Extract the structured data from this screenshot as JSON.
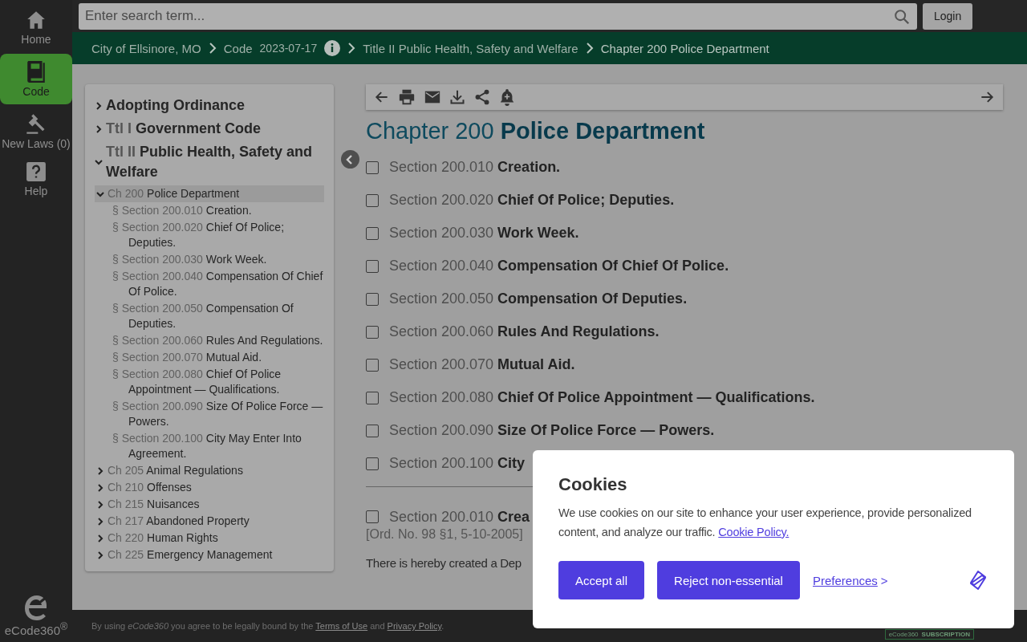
{
  "rail": {
    "items": [
      {
        "label": "Home",
        "selected": false
      },
      {
        "label": "Code",
        "selected": true
      },
      {
        "label": "New Laws (0)",
        "selected": false
      },
      {
        "label": "Help",
        "selected": false
      }
    ],
    "logo": "eCode360$^{®}$"
  },
  "search": {
    "placeholder": "Enter search term..."
  },
  "login_button": "Login",
  "breadcrumb": [
    {
      "text": "City of Ellsinore, MO"
    },
    {
      "text": "Code",
      "version": "2023-07-17"
    },
    {
      "text": "Title II Public Health, Safety and Welfare"
    },
    {
      "text": "Chapter 200 Police Department"
    }
  ],
  "toc": [
    {
      "title": "Adopting Ordinance",
      "expanded": false
    },
    {
      "prefix": "Ttl I",
      "title": "Government Code",
      "expanded": false
    },
    {
      "prefix": "Ttl II",
      "title": "Public Health, Safety and Welfare",
      "expanded": true,
      "children": [
        {
          "prefix": "Ch 200",
          "title": "Police Department",
          "expanded": true,
          "selected": true,
          "children": [
            {
              "prefix": "§ Section 200.010",
              "title": "Creation."
            },
            {
              "prefix": "§ Section 200.020",
              "title": "Chief Of Police; Deputies."
            },
            {
              "prefix": "§ Section 200.030",
              "title": "Work Week."
            },
            {
              "prefix": "§ Section 200.040",
              "title": "Compensation Of Chief Of Police."
            },
            {
              "prefix": "§ Section 200.050",
              "title": "Compensation Of Deputies."
            },
            {
              "prefix": "§ Section 200.060",
              "title": "Rules And Regulations."
            },
            {
              "prefix": "§ Section 200.070",
              "title": "Mutual Aid."
            },
            {
              "prefix": "§ Section 200.080",
              "title": "Chief Of Police Appointment — Qualifications."
            },
            {
              "prefix": "§ Section 200.090",
              "title": "Size Of Police Force — Powers."
            },
            {
              "prefix": "§ Section 200.100",
              "title": "City May Enter Into Agreement."
            }
          ]
        },
        {
          "prefix": "Ch 205",
          "title": "Animal Regulations",
          "expanded": false,
          "selected": false
        },
        {
          "prefix": "Ch 210",
          "title": "Offenses",
          "expanded": false,
          "selected": false
        },
        {
          "prefix": "Ch 215",
          "title": "Nuisances",
          "expanded": false,
          "selected": false
        },
        {
          "prefix": "Ch 217",
          "title": "Abandoned Property",
          "expanded": false,
          "selected": false
        },
        {
          "prefix": "Ch 220",
          "title": "Human Rights",
          "expanded": false,
          "selected": false
        },
        {
          "prefix": "Ch 225",
          "title": "Emergency Management",
          "expanded": false,
          "selected": false
        }
      ]
    }
  ],
  "chapter": {
    "prefix": "Chapter 200",
    "title": "Police Department"
  },
  "sections": [
    {
      "number": "Section 200.010",
      "title": "Creation.",
      "checked": false
    },
    {
      "number": "Section 200.020",
      "title": "Chief Of Police; Deputies.",
      "checked": false
    },
    {
      "number": "Section 200.030",
      "title": "Work Week.",
      "checked": false
    },
    {
      "number": "Section 200.040",
      "title": "Compensation Of Chief Of Police.",
      "checked": false
    },
    {
      "number": "Section 200.050",
      "title": "Compensation Of Deputies.",
      "checked": false
    },
    {
      "number": "Section 200.060",
      "title": "Rules And Regulations.",
      "checked": false
    },
    {
      "number": "Section 200.070",
      "title": "Mutual Aid.",
      "checked": false
    },
    {
      "number": "Section 200.080",
      "title": "Chief Of Police Appointment — Qualifications.",
      "checked": false
    },
    {
      "number": "Section 200.090",
      "title": "Size Of Police Force — Powers.",
      "checked": false
    },
    {
      "number": "Section 200.100",
      "title": "City",
      "checked": false
    }
  ],
  "section_detail": {
    "number": "Section 200.010",
    "title": "Crea",
    "checked": false,
    "history": "[Ord. No. 98 §1, 5-10-2005]",
    "text": "There is hereby created a Dep"
  },
  "footer": [
    {
      "kind": "text",
      "text": "By using *eCode360* you agree to be legally bound by the "
    },
    {
      "kind": "link",
      "text": "Terms of Use"
    },
    {
      "kind": "text",
      "text": " and "
    },
    {
      "kind": "link",
      "text": "Privacy Policy"
    },
    {
      "kind": "text",
      "text": "."
    }
  ],
  "badge": {
    "brand": "eCode360",
    "label": "SUBSCRIPTION"
  },
  "cookies": {
    "title": "Cookies",
    "text": "We use cookies on our site to enhance your user experience, provide personalized content, and analyze our traffic. ",
    "policy_link": "Cookie Policy.",
    "accept_button": "Accept all",
    "reject_button": "Reject non-essential",
    "preferences_link": "Preferences",
    "preferences_arrow": ">"
  }
}
